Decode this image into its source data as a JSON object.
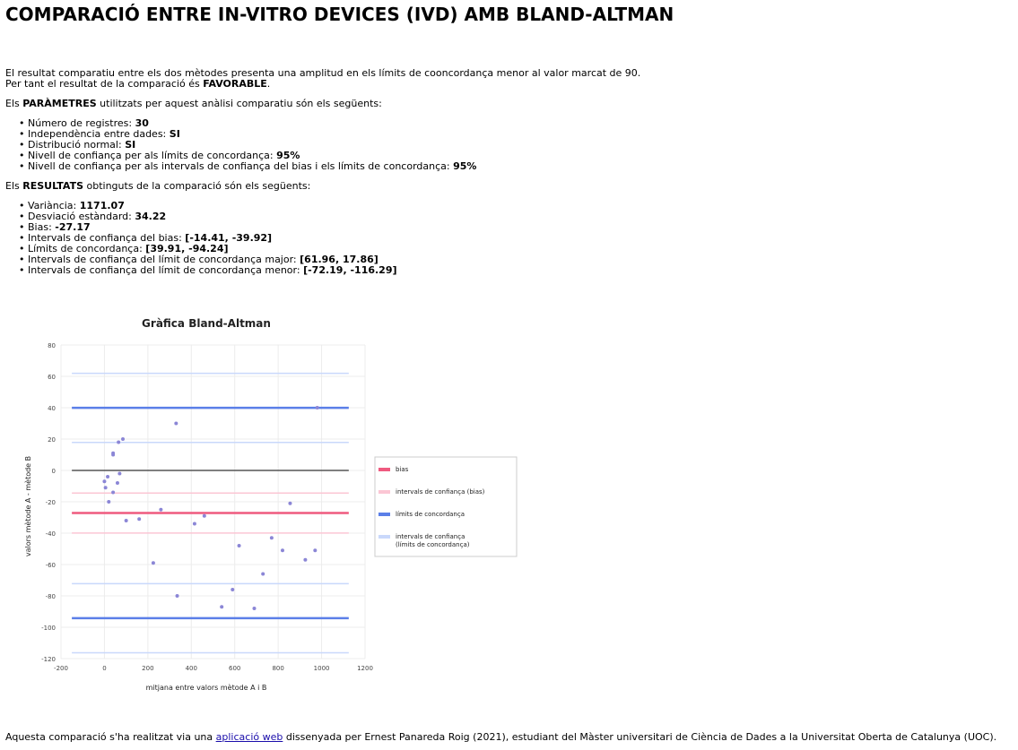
{
  "page": {
    "title": "COMPARACIÓ ENTRE IN-VITRO DEVICES (IVD) AMB BLAND-ALTMAN",
    "summary_line1": "El resultat comparatiu entre els dos mètodes presenta una amplitud en els límits de cooncordança menor al valor marcat de 90.",
    "summary_line2_prefix": "Per tant el resultat de la comparació és ",
    "summary_line2_value": "FAVORABLE",
    "summary_line2_suffix": ".",
    "params_intro_prefix": "Els ",
    "params_intro_bold": "PARÀMETRES",
    "params_intro_suffix": " utilitzats per aquest anàlisi comparatiu són els següents:",
    "params": [
      {
        "label": "Número de registres: ",
        "value": "30"
      },
      {
        "label": "Independència entre dades: ",
        "value": "SI"
      },
      {
        "label": "Distribució normal: ",
        "value": "SI"
      },
      {
        "label": "Nivell de confiança per als límits de concordança: ",
        "value": "95%"
      },
      {
        "label": "Nivell de confiança per als intervals de confiança del bias i els límits de concordança: ",
        "value": "95%"
      }
    ],
    "results_intro_prefix": "Els ",
    "results_intro_bold": "RESULTATS",
    "results_intro_suffix": " obtinguts de la comparació són els següents:",
    "results": [
      {
        "label": "Variància: ",
        "value": "1171.07"
      },
      {
        "label": "Desviació estàndard: ",
        "value": "34.22"
      },
      {
        "label": "Bias: ",
        "value": "-27.17"
      },
      {
        "label": "Intervals de confiança del bias: ",
        "value": "[-14.41, -39.92]"
      },
      {
        "label": "Límits de concordança: ",
        "value": "[39.91, -94.24]"
      },
      {
        "label": "Intervals de confiança del límit de concordança major: ",
        "value": "[61.96, 17.86]"
      },
      {
        "label": "Intervals de confiança del límit de concordança menor: ",
        "value": "[-72.19, -116.29]"
      }
    ],
    "footer_prefix": "Aquesta comparació s'ha realitzat via una ",
    "footer_link": "aplicació web",
    "footer_suffix": " dissenyada per Ernest Panareda Roig (2021), estudiant del Màster universitari de Ciència de Dades a la Universitat Oberta de Catalunya (UOC)."
  },
  "chart_data": {
    "type": "scatter",
    "title": "Gràfica Bland-Altman",
    "xlabel": "mitjana entre valors mètode A i B",
    "ylabel": "valors mètode A - mètode B",
    "xlim": [
      -200,
      1200
    ],
    "ylim": [
      -120,
      80
    ],
    "xticks": [
      -200,
      0,
      200,
      400,
      600,
      800,
      1000,
      1200
    ],
    "yticks": [
      80,
      60,
      40,
      20,
      0,
      -20,
      -40,
      -60,
      -80,
      -100,
      -120
    ],
    "grid": true,
    "legend_position": "right",
    "line_x_range": [
      -150,
      1125
    ],
    "reference_lines": [
      {
        "name": "zero",
        "y": 0,
        "color": "#555555",
        "weight": "normal",
        "in_legend": false
      },
      {
        "name": "intervals de confiança (límits de concordança)",
        "y": 61.96,
        "color": "#c9d8fb",
        "weight": "normal",
        "in_legend": true
      },
      {
        "name": "límits de concordança",
        "y": 39.91,
        "color": "#5b7fe8",
        "weight": "thick",
        "in_legend": true
      },
      {
        "name": "intervals de confiança (límits de concordança)",
        "y": 17.86,
        "color": "#c9d8fb",
        "weight": "normal",
        "in_legend": false
      },
      {
        "name": "intervals de confiança (bias)",
        "y": -14.41,
        "color": "#fbc6d4",
        "weight": "normal",
        "in_legend": true
      },
      {
        "name": "bias",
        "y": -27.17,
        "color": "#ef5a7f",
        "weight": "thick",
        "in_legend": true
      },
      {
        "name": "intervals de confiança (bias)",
        "y": -39.92,
        "color": "#fbc6d4",
        "weight": "normal",
        "in_legend": false
      },
      {
        "name": "intervals de confiança (límits de concordança)",
        "y": -72.19,
        "color": "#c9d8fb",
        "weight": "normal",
        "in_legend": false
      },
      {
        "name": "límits de concordança",
        "y": -94.24,
        "color": "#5b7fe8",
        "weight": "thick",
        "in_legend": false
      },
      {
        "name": "intervals de confiança (límits de concordança)",
        "y": -116.29,
        "color": "#c9d8fb",
        "weight": "normal",
        "in_legend": false
      }
    ],
    "legend": [
      {
        "name": "bias",
        "color": "#ef5a7f"
      },
      {
        "name": "intervals de confiança (bias)",
        "color": "#fbc6d4"
      },
      {
        "name": "límits de concordança",
        "color": "#5b7fe8"
      },
      {
        "name": "intervals de confiança (límits de concordança)",
        "color": "#c9d8fb"
      }
    ],
    "point_color": "#8b86d6",
    "points": [
      {
        "x": 0,
        "y": -7
      },
      {
        "x": 5,
        "y": -11
      },
      {
        "x": 15,
        "y": -4
      },
      {
        "x": 20,
        "y": -20
      },
      {
        "x": 40,
        "y": 10
      },
      {
        "x": 40,
        "y": 11
      },
      {
        "x": 40,
        "y": -14
      },
      {
        "x": 60,
        "y": -8
      },
      {
        "x": 65,
        "y": 18
      },
      {
        "x": 70,
        "y": -2
      },
      {
        "x": 85,
        "y": 20
      },
      {
        "x": 100,
        "y": -32
      },
      {
        "x": 160,
        "y": -31
      },
      {
        "x": 225,
        "y": -59
      },
      {
        "x": 260,
        "y": -25
      },
      {
        "x": 330,
        "y": 30
      },
      {
        "x": 335,
        "y": -80
      },
      {
        "x": 415,
        "y": -34
      },
      {
        "x": 460,
        "y": -29
      },
      {
        "x": 540,
        "y": -87
      },
      {
        "x": 590,
        "y": -76
      },
      {
        "x": 620,
        "y": -48
      },
      {
        "x": 690,
        "y": -88
      },
      {
        "x": 730,
        "y": -66
      },
      {
        "x": 770,
        "y": -43
      },
      {
        "x": 820,
        "y": -51
      },
      {
        "x": 855,
        "y": -21
      },
      {
        "x": 925,
        "y": -57
      },
      {
        "x": 970,
        "y": -51
      },
      {
        "x": 980,
        "y": 40
      }
    ]
  }
}
